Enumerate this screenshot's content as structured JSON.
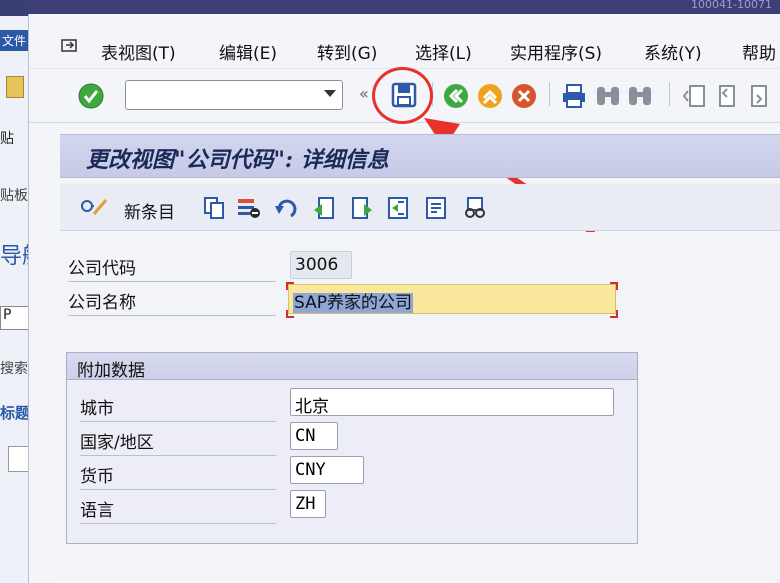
{
  "left_pane": {
    "file_label": "文件",
    "paste_label": "贴",
    "clipboard_label": "贴板",
    "nav_label": "导航",
    "p_field": "P",
    "search_label": "搜索",
    "topic_label": "标题"
  },
  "window": {
    "title_fragment": "100041-10071"
  },
  "menu": {
    "items": [
      "表视图(T)",
      "编辑(E)",
      "转到(G)",
      "选择(L)",
      "实用程序(S)",
      "系统(Y)",
      "帮助"
    ]
  },
  "toolbar": {
    "command_field_value": ""
  },
  "page": {
    "title": "更改视图\"公司代码\": 详细信息",
    "new_entries_label": "新条目"
  },
  "form": {
    "company_code_label": "公司代码",
    "company_code_value": "3006",
    "company_name_label": "公司名称",
    "company_name_value": "SAP养家的公司"
  },
  "additional": {
    "title": "附加数据",
    "city_label": "城市",
    "city_value": "北京",
    "country_label": "国家/地区",
    "country_value": "CN",
    "currency_label": "货币",
    "currency_value": "CNY",
    "language_label": "语言",
    "language_value": "ZH"
  },
  "colors": {
    "highlight_red": "#e8312a",
    "title_bar": "#c6cae6",
    "input_highlight": "#f9e79b"
  }
}
